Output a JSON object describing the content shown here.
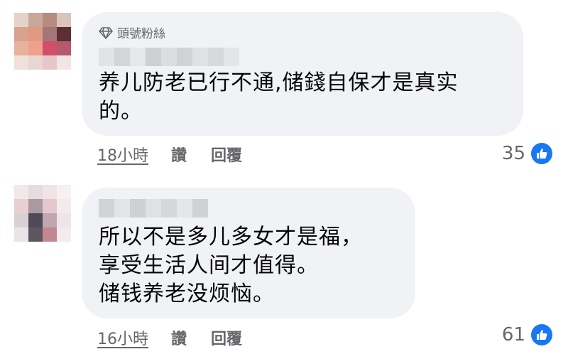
{
  "comments": [
    {
      "badge": "頭號粉絲",
      "text": "养儿防老已行不通,储錢自保才是真实\n的。",
      "time": "18小時",
      "like_action": "讚",
      "reply_action": "回覆",
      "reaction_count": "35"
    },
    {
      "text": "所以不是多儿多女才是福，\n享受生活人间才值得。\n储钱养老没烦恼。",
      "time": "16小時",
      "like_action": "讚",
      "reply_action": "回覆",
      "reaction_count": "61"
    }
  ],
  "colors": {
    "bubble": "#f0f2f5",
    "secondary_text": "#65676b",
    "like_blue": "#1877f2"
  },
  "icons": [
    "diamond-icon",
    "thumbs-up-icon"
  ]
}
